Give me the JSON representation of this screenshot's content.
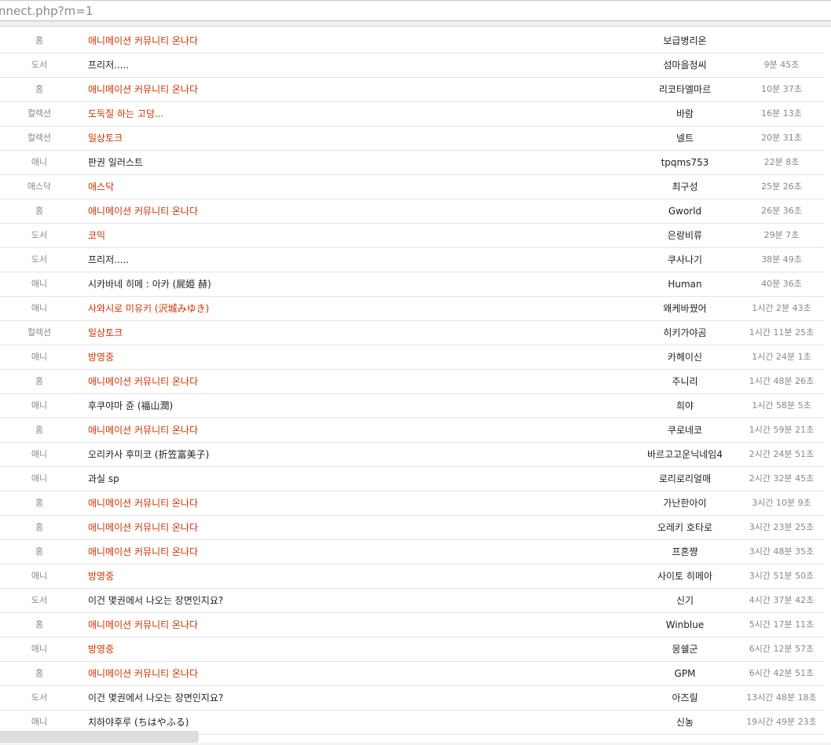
{
  "url_bar": {
    "text": "nnect.php?m=1"
  },
  "rows": [
    {
      "category": "홈",
      "title": "애니메이션 커뮤니티 온나다",
      "hot": true,
      "user": "보급병리온",
      "time": ""
    },
    {
      "category": "도서",
      "title": "프리저.....",
      "hot": false,
      "user": "섬마을정씨",
      "time": "9분 45초"
    },
    {
      "category": "홈",
      "title": "애니메이션 커뮤니티 온나다",
      "hot": true,
      "user": "리코타엘마르",
      "time": "10분 37초"
    },
    {
      "category": "컬렉션",
      "title": "도둑질 하는 고덩...",
      "hot": true,
      "user": "바람",
      "time": "16분 13초"
    },
    {
      "category": "컬렉션",
      "title": "일상토크",
      "hot": true,
      "user": "넬트",
      "time": "20분 31초"
    },
    {
      "category": "애니",
      "title": "판권 일러스트",
      "hot": false,
      "user": "tpqms753",
      "time": "22분 8초"
    },
    {
      "category": "애스닥",
      "title": "애스닥",
      "hot": true,
      "user": "최구성",
      "time": "25분 26초"
    },
    {
      "category": "홈",
      "title": "애니메이션 커뮤니티 온나다",
      "hot": true,
      "user": "Gworld",
      "time": "26분 36초"
    },
    {
      "category": "도서",
      "title": "코믹",
      "hot": true,
      "user": "은랑비류",
      "time": "29분 7초"
    },
    {
      "category": "도서",
      "title": "프리저.....",
      "hot": false,
      "user": "쿠사나기",
      "time": "38분 49초"
    },
    {
      "category": "애니",
      "title": "시카바네 히메 : 아카 (屍姫 赫)",
      "hot": false,
      "user": "Human",
      "time": "40분 36초"
    },
    {
      "category": "애니",
      "title": "사와시로 미유키 (沢城みゆき)",
      "hot": true,
      "user": "왜케바꿨어",
      "time": "1시간 2분 43초"
    },
    {
      "category": "컬렉션",
      "title": "일상토크",
      "hot": true,
      "user": "히키가야곰",
      "time": "1시간 11분 25초"
    },
    {
      "category": "애니",
      "title": "방영중",
      "hot": true,
      "user": "카헤이신",
      "time": "1시간 24분 1초"
    },
    {
      "category": "홈",
      "title": "애니메이션 커뮤니티 온나다",
      "hot": true,
      "user": "주니리",
      "time": "1시간 48분 26초"
    },
    {
      "category": "애니",
      "title": "후쿠야마 쥰 (福山潤)",
      "hot": false,
      "user": "희야",
      "time": "1시간 58분 5초"
    },
    {
      "category": "홈",
      "title": "애니메이션 커뮤니티 온나다",
      "hot": true,
      "user": "쿠로네코",
      "time": "1시간 59분 21초"
    },
    {
      "category": "애니",
      "title": "오리카사 후미코 (折笠富美子)",
      "hot": false,
      "user": "바르고고운닉네임4",
      "time": "2시간 24분 51초"
    },
    {
      "category": "애니",
      "title": "과실 sp",
      "hot": false,
      "user": "로리로리얼매",
      "time": "2시간 32분 45초"
    },
    {
      "category": "홈",
      "title": "애니메이션 커뮤니티 온나다",
      "hot": true,
      "user": "가난한아이",
      "time": "3시간 10분 9초"
    },
    {
      "category": "홈",
      "title": "애니메이션 커뮤니티 온나다",
      "hot": true,
      "user": "오레키 호타로",
      "time": "3시간 23분 25초"
    },
    {
      "category": "홈",
      "title": "애니메이션 커뮤니티 온나다",
      "hot": true,
      "user": "프혼쨩",
      "time": "3시간 48분 35초"
    },
    {
      "category": "애니",
      "title": "방영중",
      "hot": true,
      "user": "사이토 히메아",
      "time": "3시간 51분 50초"
    },
    {
      "category": "도서",
      "title": "이건 몇권에서 나오는 장면인지요?",
      "hot": false,
      "user": "신기",
      "time": "4시간 37분 42초"
    },
    {
      "category": "홈",
      "title": "애니메이션 커뮤니티 온나다",
      "hot": true,
      "user": "Winblue",
      "time": "5시간 17분 11초"
    },
    {
      "category": "애니",
      "title": "방영중",
      "hot": true,
      "user": "몽쉘군",
      "time": "6시간 12분 57초"
    },
    {
      "category": "홈",
      "title": "애니메이션 커뮤니티 온나다",
      "hot": true,
      "user": "GPM",
      "time": "6시간 42분 51초"
    },
    {
      "category": "도서",
      "title": "이건 몇권에서 나오는 장면인지요?",
      "hot": false,
      "user": "아즈릴",
      "time": "13시간 48분 18초"
    },
    {
      "category": "애니",
      "title": "치하야후루 (ちはやふる)",
      "hot": false,
      "user": "신농",
      "time": "19시간 49분 23초"
    }
  ],
  "colors": {
    "hot_title": "#cc3300",
    "normal_text": "#222222",
    "muted_text": "#888888",
    "row_border": "#e3e3e3"
  }
}
